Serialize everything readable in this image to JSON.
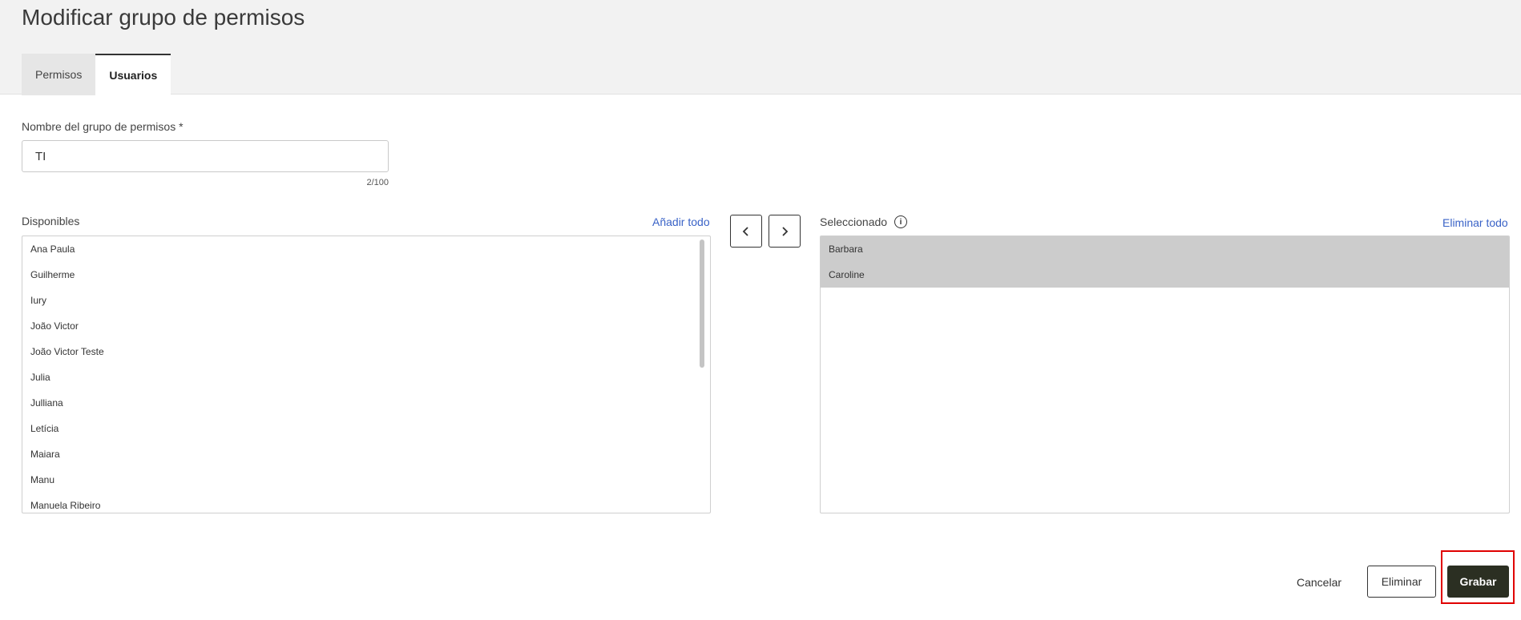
{
  "page_title": "Modificar grupo de permisos",
  "tabs": [
    {
      "label": "Permisos"
    },
    {
      "label": "Usuarios"
    }
  ],
  "name_field": {
    "label": "Nombre del grupo de permisos *",
    "value": "TI",
    "counter": "2/100"
  },
  "available": {
    "label": "Disponibles",
    "add_all": "Añadir todo",
    "items": [
      "Ana Paula",
      "Guilherme",
      "Iury",
      "João Victor",
      "João Victor Teste",
      "Julia",
      "Julliana",
      "Letícia",
      "Maiara",
      "Manu",
      "Manuela Ribeiro"
    ]
  },
  "selected": {
    "label": "Seleccionado",
    "remove_all": "Eliminar todo",
    "info_icon": "info-icon",
    "items": [
      "Barbara",
      "Caroline"
    ]
  },
  "transfer": {
    "left_icon": "chevron-left-icon",
    "right_icon": "chevron-right-icon"
  },
  "footer": {
    "cancel": "Cancelar",
    "delete": "Eliminar",
    "save": "Grabar"
  },
  "colors": {
    "link": "#3a63c7",
    "primary": "#2b2f22",
    "highlight": "#e00000",
    "selected_bg": "#cccccc"
  }
}
